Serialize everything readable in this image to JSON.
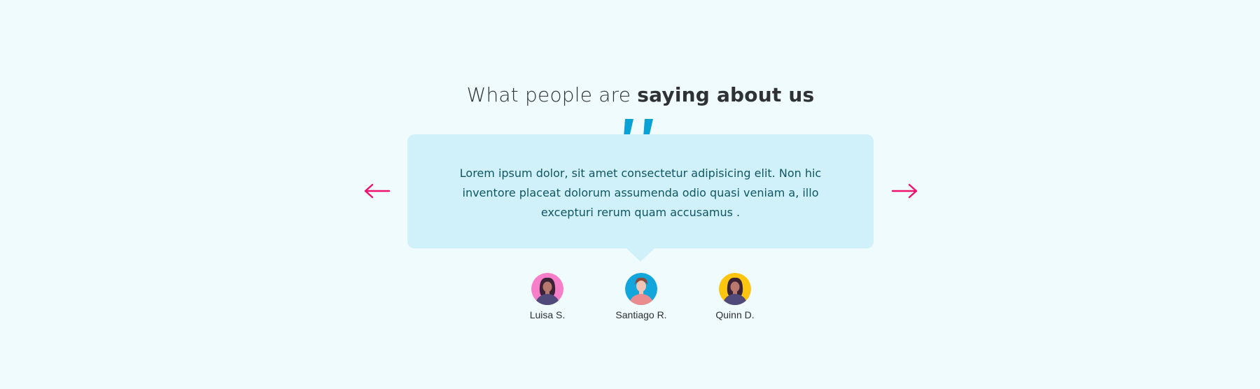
{
  "section": {
    "heading_light": "What people are",
    "heading_bold": "saying about us"
  },
  "testimonial": {
    "quote_icon": "quote-icon",
    "text": "Lorem ipsum dolor, sit amet consectetur adipisicing elit. Non hic inventore placeat dolorum assumenda odio quasi veniam a, illo excepturi rerum quam accusamus ."
  },
  "navigation": {
    "prev_icon": "arrow-left-icon",
    "next_icon": "arrow-right-icon",
    "accent_color": "#f0116f"
  },
  "people": [
    {
      "name": "Luisa S.",
      "avatar_bg": "#f77fc9"
    },
    {
      "name": "Santiago R.",
      "avatar_bg": "#12a6dd"
    },
    {
      "name": "Quinn D.",
      "avatar_bg": "#fdc50f"
    }
  ],
  "colors": {
    "background": "#effbfd",
    "bubble": "#d0f1fa",
    "quote_mark": "#0aa1d4",
    "text": "#0f5663"
  }
}
